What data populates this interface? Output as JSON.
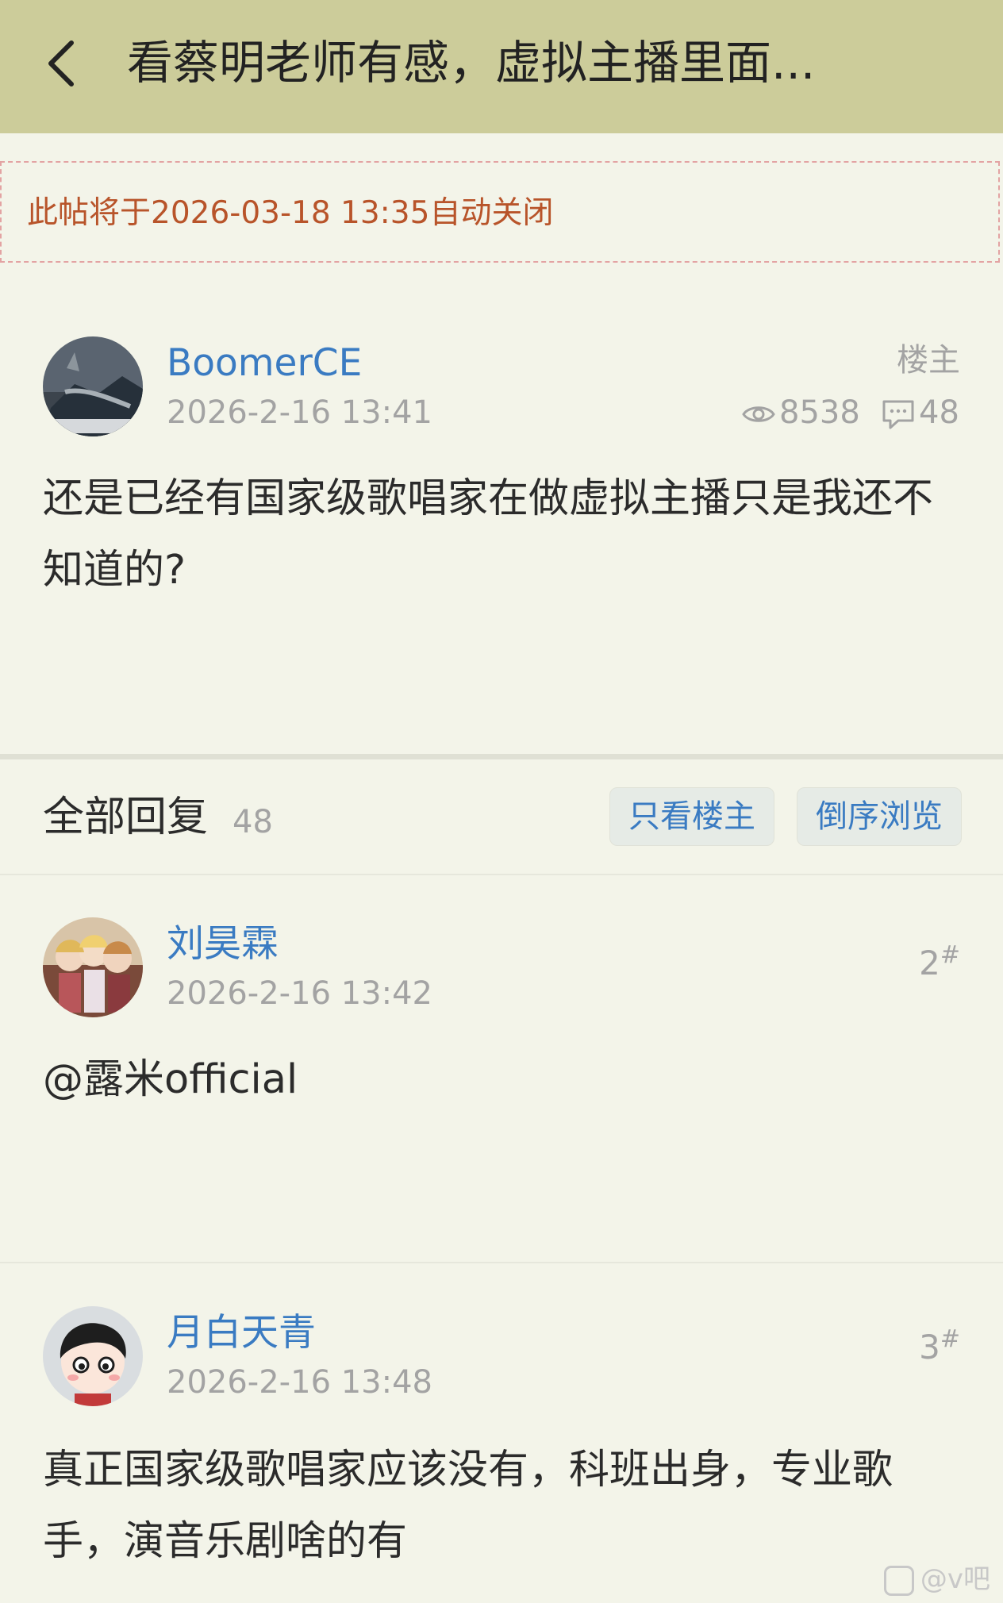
{
  "header": {
    "title": "看蔡明老师有感，虚拟主播里面..."
  },
  "notice": {
    "text": "此帖将于2026-03-18 13:35自动关闭"
  },
  "op": {
    "username": "BoomerCE",
    "time": "2026-2-16 13:41",
    "tag": "楼主",
    "views": "8538",
    "comments": "48",
    "content": "还是已经有国家级歌唱家在做虚拟主播只是我还不知道的?"
  },
  "replies_header": {
    "title": "全部回复",
    "count": "48",
    "only_op_label": "只看楼主",
    "reverse_label": "倒序浏览"
  },
  "replies": [
    {
      "username": "刘昊霖",
      "time": "2026-2-16 13:42",
      "floor": "2",
      "floor_mark": "#",
      "content": "@露米official"
    },
    {
      "username": "月白天青",
      "time": "2026-2-16 13:48",
      "floor": "3",
      "floor_mark": "#",
      "content": "真正国家级歌唱家应该没有，科班出身，专业歌手，演音乐剧啥的有"
    }
  ],
  "watermark": {
    "text": "@v吧"
  },
  "colors": {
    "header_bg": "#cccc9a",
    "page_bg": "#f3f4e9",
    "link_blue": "#3a7bc2",
    "notice_orange": "#b8542a",
    "muted_gray": "#a3a3a3"
  }
}
